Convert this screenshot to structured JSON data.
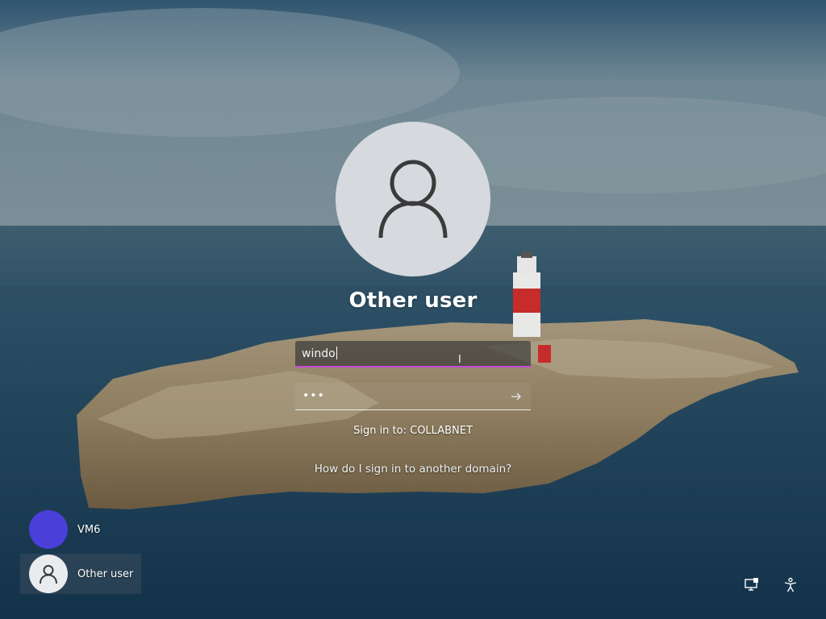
{
  "login": {
    "username": "Other user",
    "username_field_value": "windo",
    "password_mask": "•••",
    "sign_in_to": "Sign in to: COLLABNET",
    "other_domain_link": "How do I sign in to another domain?"
  },
  "users": [
    {
      "name": "VM6",
      "avatar_color": "#4a3fd9"
    },
    {
      "name": "Other user",
      "avatar_color": "#e9ebee"
    }
  ],
  "icons": {
    "avatar": "person-icon",
    "submit": "arrow-right-icon",
    "network": "network-icon",
    "accessibility": "accessibility-icon"
  },
  "colors": {
    "focus_underline": "#c74bd6",
    "avatar_bg": "#d6d9dd"
  }
}
